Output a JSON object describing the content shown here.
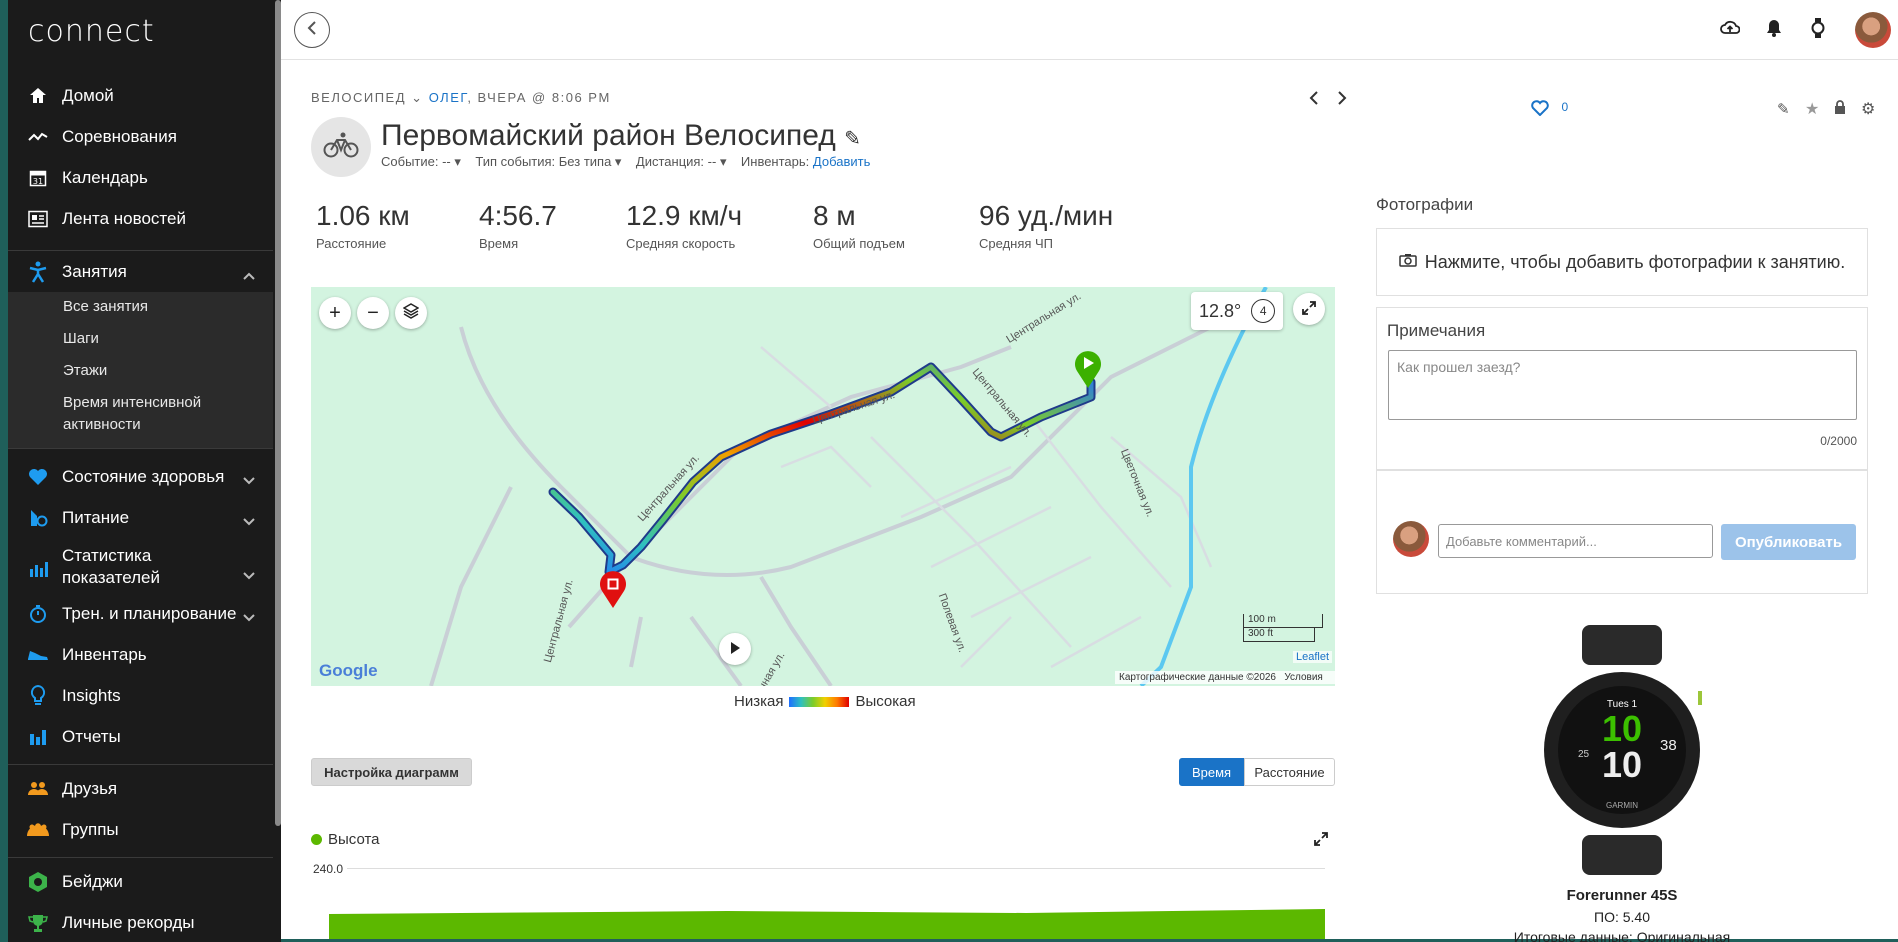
{
  "app": {
    "logo": "connect"
  },
  "sidebar": {
    "items": [
      {
        "label": "Домой",
        "icon": "home-icon"
      },
      {
        "label": "Соревнования",
        "icon": "trend-icon"
      },
      {
        "label": "Календарь",
        "icon": "calendar-icon"
      },
      {
        "label": "Лента новостей",
        "icon": "newsfeed-icon"
      },
      {
        "label": "Занятия",
        "icon": "activity-icon"
      },
      {
        "label": "Состояние здоровья",
        "icon": "heart-icon"
      },
      {
        "label": "Питание",
        "icon": "nutrition-icon"
      },
      {
        "label": "Статистика показателей",
        "icon": "stats-icon"
      },
      {
        "label": "Трен. и планирование",
        "icon": "stopwatch-icon"
      },
      {
        "label": "Инвентарь",
        "icon": "shoe-icon"
      },
      {
        "label": "Insights",
        "icon": "lightbulb-icon"
      },
      {
        "label": "Отчеты",
        "icon": "reports-icon"
      },
      {
        "label": "Друзья",
        "icon": "friends-icon"
      },
      {
        "label": "Группы",
        "icon": "groups-icon"
      },
      {
        "label": "Бейджи",
        "icon": "badge-icon"
      },
      {
        "label": "Личные рекорды",
        "icon": "trophy-icon"
      }
    ],
    "sub_items": [
      "Все занятия",
      "Шаги",
      "Этажи",
      "Время интенсивной",
      "активности"
    ]
  },
  "activity": {
    "type_label": "ВЕЛОСИПЕД",
    "user": "ОЛЕГ",
    "when": ", ВЧЕРА @ 8:06 PM",
    "title": "Первомайский район Велосипед",
    "event_label": "Событие: --",
    "event_type_label": "Тип события: Без типа",
    "distance_label": "Дистанция: --",
    "gear_label": "Инвентарь:",
    "gear_add": "Добавить",
    "likes": "0"
  },
  "stats": [
    {
      "value": "1.06 км",
      "label": "Расстояние"
    },
    {
      "value": "4:56.7",
      "label": "Время"
    },
    {
      "value": "12.9 км/ч",
      "label": "Средняя скорость"
    },
    {
      "value": "8 м",
      "label": "Общий подъем"
    },
    {
      "value": "96 уд./мин",
      "label": "Средняя ЧП"
    }
  ],
  "map": {
    "temperature": "12.8°",
    "wind": "4",
    "streets": [
      "Центральная ул.",
      "Центральная ул.",
      "Центральная ул.",
      "Центральная ул.",
      "Цветочная ул.",
      "Полевая ул.",
      "Центральная ул.",
      "чная ул.",
      "Центральная ул."
    ],
    "scale_m": "100 m",
    "scale_ft": "300 ft",
    "attribution_leaflet": "Leaflet",
    "attribution_data": "Картографические данные ©2026",
    "attribution_terms": "Условия",
    "google": "Google",
    "legend_low": "Низкая",
    "legend_high": "Высокая"
  },
  "chart": {
    "settings_button": "Настройка диаграмм",
    "toggle_time": "Время",
    "toggle_distance": "Расстояние",
    "legend": "Высота",
    "y_top": "240.0"
  },
  "right": {
    "photos_header": "Фотографии",
    "photos_cta": "Нажмите, чтобы добавить фотографии к занятию.",
    "notes_header": "Примечания",
    "notes_placeholder": "Как прошел заезд?",
    "notes_counter": "0/2000",
    "comment_placeholder": "Добавьте комментарий...",
    "publish": "Опубликовать",
    "device_name": "Forerunner 45S",
    "device_fw": "ПО: 5.40",
    "device_extra": "Итоговые данные: Оригинальная"
  },
  "watch": {
    "day": "Tues 1",
    "hour": "10",
    "minute": "10",
    "sec": "38",
    "left": "25",
    "brand": "GARMIN"
  },
  "colors": {
    "accent": "#1a73c7",
    "sidebar": "#1b1b1b",
    "map": "#d3f4e0",
    "elevation": "#5cb800"
  }
}
